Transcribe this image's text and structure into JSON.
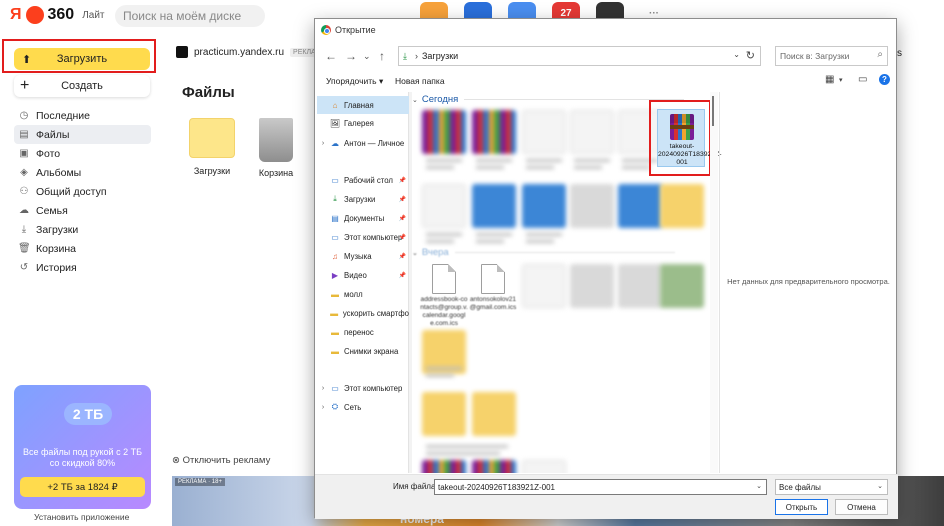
{
  "app": {
    "logo_ya": "Я",
    "logo_360": "360",
    "logo_lite": "Лайт",
    "search_placeholder": "Поиск на моём диске",
    "top_apps": [
      {
        "name": "mail-app-icon",
        "color": "#f7a23b",
        "text": ""
      },
      {
        "name": "messenger-app-icon",
        "color": "#2a6fdb",
        "text": ""
      },
      {
        "name": "disk-app-icon",
        "color": "#4a8ef0",
        "text": ""
      },
      {
        "name": "calendar-app-icon",
        "color": "#e53935",
        "text": "27"
      },
      {
        "name": "telemost-app-icon",
        "color": "#333333",
        "text": ""
      },
      {
        "name": "more-apps-icon",
        "color": "#ffffff",
        "text": "···"
      }
    ]
  },
  "sidebar": {
    "upload_label": "Загрузить",
    "create_label": "Создать",
    "items": [
      {
        "label": "Последние",
        "icon": "clock-icon",
        "glyph": "◷",
        "active": false
      },
      {
        "label": "Файлы",
        "icon": "files-icon",
        "glyph": "▤",
        "active": true
      },
      {
        "label": "Фото",
        "icon": "photo-icon",
        "glyph": "▣",
        "active": false
      },
      {
        "label": "Альбомы",
        "icon": "albums-icon",
        "glyph": "◈",
        "active": false
      },
      {
        "label": "Общий доступ",
        "icon": "shared-icon",
        "glyph": "⚇",
        "active": false
      },
      {
        "label": "Семья",
        "icon": "family-icon",
        "glyph": "☁",
        "active": false
      },
      {
        "label": "Загрузки",
        "icon": "downloads-icon",
        "glyph": "⤓",
        "active": false
      },
      {
        "label": "Корзина",
        "icon": "trash-icon",
        "glyph": "🗑",
        "active": false
      },
      {
        "label": "История",
        "icon": "history-icon",
        "glyph": "↺",
        "active": false
      }
    ],
    "promo": {
      "badge": "2 ТБ",
      "text": "Все файлы под рукой с 2 ТБ со скидкой 80%",
      "button": "+2 ТБ за 1824 ₽"
    },
    "install_app": "Установить приложение"
  },
  "main": {
    "ad_domain": "practicum.yandex.ru",
    "ad_tag": "РЕКЛАМА · 18+",
    "title": "Файлы",
    "tiles": [
      {
        "label": "Загрузки",
        "kind": "folder"
      },
      {
        "label": "Корзина",
        "kind": "trash"
      }
    ],
    "disable_ad": "Отключить рекламу",
    "banner_tag": "РЕКЛАМА · 18+",
    "banner_text": "номера"
  },
  "dialog": {
    "title": "Открытие",
    "breadcrumb": "Загрузки",
    "search_placeholder": "Поиск в: Загрузки",
    "organize": "Упорядочить ▾",
    "new_folder": "Новая папка",
    "help": "?",
    "tree": [
      {
        "label": "Главная",
        "icon": "home-icon",
        "glyph": "⌂",
        "chev": "",
        "selected": true,
        "pin": false
      },
      {
        "label": "Галерея",
        "icon": "gallery-icon",
        "glyph": "🖼",
        "chev": "",
        "selected": false,
        "pin": false
      },
      {
        "label": "Антон — Личное",
        "icon": "onedrive-icon",
        "glyph": "☁",
        "chev": "›",
        "selected": false,
        "pin": false
      },
      {
        "label": "Рабочий стол",
        "icon": "desktop-icon",
        "glyph": "▭",
        "chev": "",
        "selected": false,
        "pin": true
      },
      {
        "label": "Загрузки",
        "icon": "download-icon",
        "glyph": "⤓",
        "chev": "",
        "selected": false,
        "pin": true
      },
      {
        "label": "Документы",
        "icon": "documents-icon",
        "glyph": "▤",
        "chev": "",
        "selected": false,
        "pin": true
      },
      {
        "label": "Этот компьютер",
        "icon": "computer-icon",
        "glyph": "▭",
        "chev": "",
        "selected": false,
        "pin": true
      },
      {
        "label": "Музыка",
        "icon": "music-icon",
        "glyph": "♫",
        "chev": "",
        "selected": false,
        "pin": true
      },
      {
        "label": "Видео",
        "icon": "video-icon",
        "glyph": "▶",
        "chev": "",
        "selected": false,
        "pin": true
      },
      {
        "label": "молл",
        "icon": "folder-icon",
        "glyph": "▬",
        "chev": "",
        "selected": false,
        "pin": false
      },
      {
        "label": "ускорить смартфо",
        "icon": "folder-icon",
        "glyph": "▬",
        "chev": "",
        "selected": false,
        "pin": false
      },
      {
        "label": "перенос",
        "icon": "folder-icon",
        "glyph": "▬",
        "chev": "",
        "selected": false,
        "pin": false
      },
      {
        "label": "Снимки экрана",
        "icon": "folder-icon",
        "glyph": "▬",
        "chev": "",
        "selected": false,
        "pin": false
      },
      {
        "label": "Этот компьютер",
        "icon": "computer-icon",
        "glyph": "▭",
        "chev": "›",
        "selected": false,
        "pin": false
      },
      {
        "label": "Сеть",
        "icon": "network-icon",
        "glyph": "⛭",
        "chev": "›",
        "selected": false,
        "pin": false
      }
    ],
    "group_today": "Сегодня",
    "group_yesterday": "Вчера",
    "selected_file": "takeout-20240926T183921Z-001",
    "doc_files": [
      {
        "name": "addressbook-contacts@group.v.calendar.google.com.ics"
      },
      {
        "name": "antonsokolov21@gmail.com.ics"
      }
    ],
    "preview_text": "Нет данных для предварительного просмотра.",
    "filename_label": "Имя файла:",
    "filename_value": "takeout-20240926T183921Z-001",
    "filetype_value": "Все файлы",
    "open_button": "Открыть",
    "cancel_button": "Отмена"
  },
  "right_edge_text": "s"
}
